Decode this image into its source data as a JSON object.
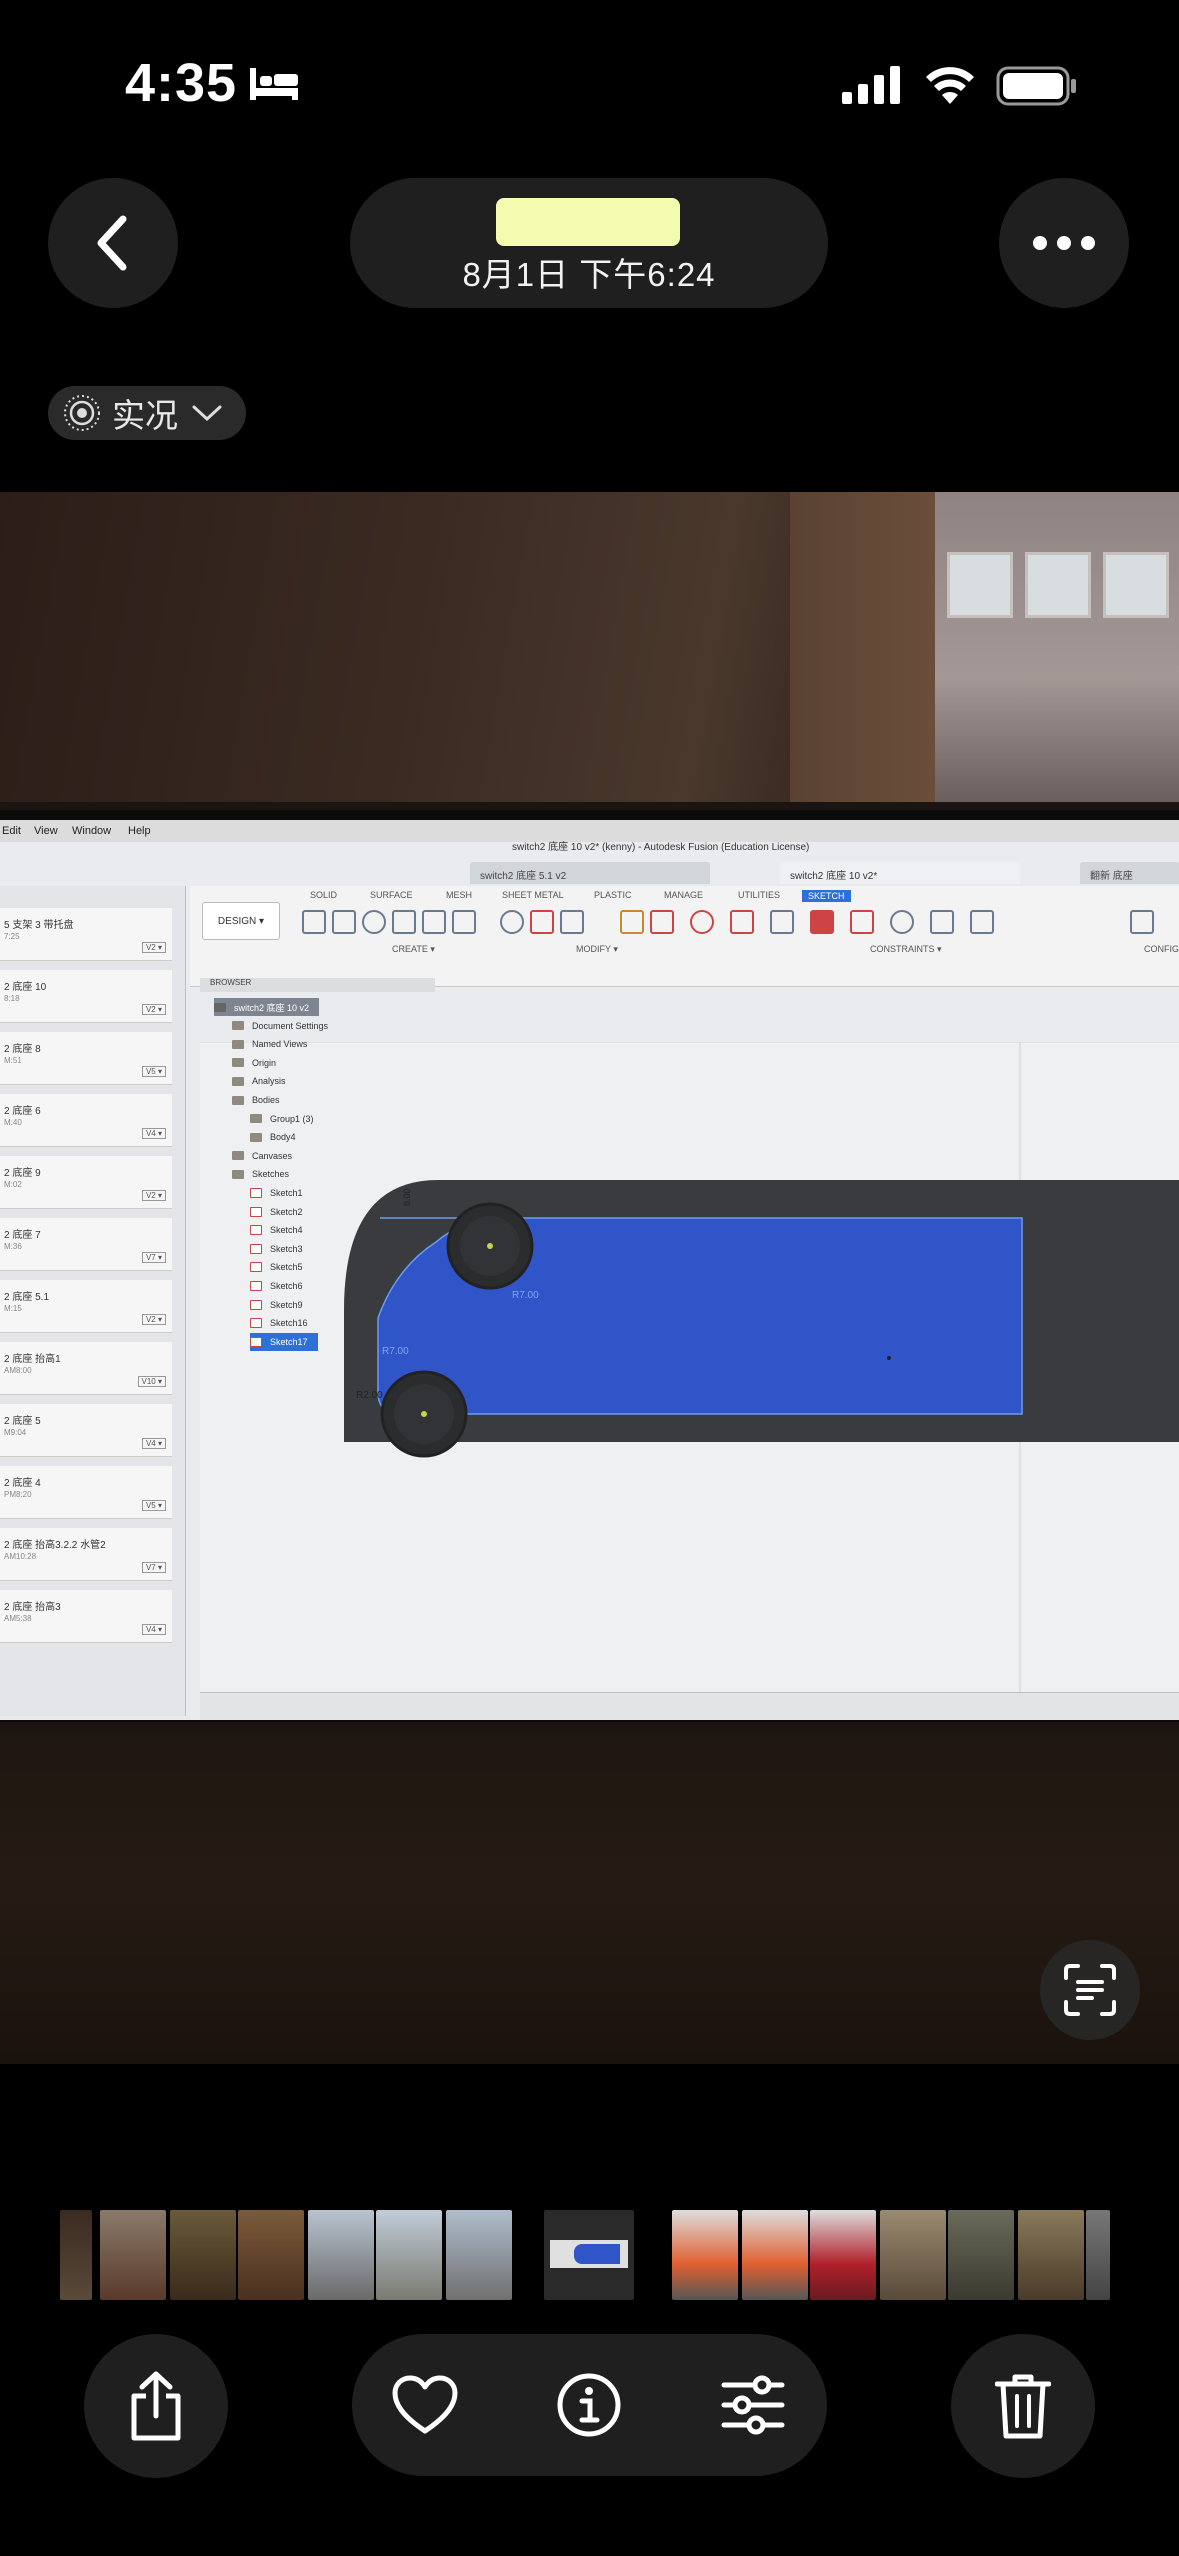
{
  "status_bar": {
    "time": "4:35"
  },
  "header": {
    "date": "8月1日  下午6:24",
    "live_badge": "实况"
  },
  "screenshot_app": {
    "menu": [
      "Edit",
      "View",
      "Window",
      "Help"
    ],
    "window_title": "switch2 底座 10 v2* (kenny) - Autodesk Fusion (Education License)",
    "doc_tabs": [
      "switch2 底座 5.1 v2",
      "switch2 底座 10 v2*",
      "翻新 底座"
    ],
    "workspace_button": "DESIGN ▾",
    "toolbar_tabs": [
      "SOLID",
      "SURFACE",
      "MESH",
      "SHEET METAL",
      "PLASTIC",
      "MANAGE",
      "UTILITIES",
      "SKETCH"
    ],
    "toolbar_groups": [
      "CREATE ▾",
      "MODIFY ▾",
      "CONSTRAINTS ▾",
      "CONFIG"
    ],
    "data_panel_items": [
      {
        "name": "5 支架 3 带托盘",
        "time": "7:25",
        "ver": "V2 ▾"
      },
      {
        "name": "2 底座 10",
        "time": "8:18",
        "ver": "V2 ▾"
      },
      {
        "name": "2 底座 8",
        "time": "M:51",
        "ver": "V5 ▾"
      },
      {
        "name": "2 底座 6",
        "time": "M:40",
        "ver": "V4 ▾"
      },
      {
        "name": "2 底座 9",
        "time": "M:02",
        "ver": "V2 ▾"
      },
      {
        "name": "2 底座 7",
        "time": "M:36",
        "ver": "V7 ▾"
      },
      {
        "name": "2 底座 5.1",
        "time": "M:15",
        "ver": "V2 ▾"
      },
      {
        "name": "2 底座 抬高1",
        "time": "AM8:00",
        "ver": "V10 ▾"
      },
      {
        "name": "2 底座 5",
        "time": "M9:04",
        "ver": "V4 ▾"
      },
      {
        "name": "2 底座 4",
        "time": "PM8:20",
        "ver": "V5 ▾"
      },
      {
        "name": "2 底座 抬高3.2.2 水管2",
        "time": "AM10:28",
        "ver": "V7 ▾"
      },
      {
        "name": "2 底座 抬高3",
        "time": "AM5:38",
        "ver": "V4 ▾"
      }
    ],
    "browser": {
      "title": "BROWSER",
      "items": [
        {
          "label": "switch2 底座 10 v2",
          "indent": 0,
          "kind": "root"
        },
        {
          "label": "Document Settings",
          "indent": 1,
          "kind": "folder"
        },
        {
          "label": "Named Views",
          "indent": 1,
          "kind": "folder"
        },
        {
          "label": "Origin",
          "indent": 1,
          "kind": "folder"
        },
        {
          "label": "Analysis",
          "indent": 1,
          "kind": "folder"
        },
        {
          "label": "Bodies",
          "indent": 1,
          "kind": "folder"
        },
        {
          "label": "Group1 (3)",
          "indent": 2,
          "kind": "folder"
        },
        {
          "label": "Body4",
          "indent": 2,
          "kind": "body"
        },
        {
          "label": "Canvases",
          "indent": 1,
          "kind": "folder"
        },
        {
          "label": "Sketches",
          "indent": 1,
          "kind": "folder"
        },
        {
          "label": "Sketch1",
          "indent": 2,
          "kind": "sketch"
        },
        {
          "label": "Sketch2",
          "indent": 2,
          "kind": "sketch"
        },
        {
          "label": "Sketch4",
          "indent": 2,
          "kind": "sketch"
        },
        {
          "label": "Sketch3",
          "indent": 2,
          "kind": "sketch"
        },
        {
          "label": "Sketch5",
          "indent": 2,
          "kind": "sketch"
        },
        {
          "label": "Sketch6",
          "indent": 2,
          "kind": "sketch"
        },
        {
          "label": "Sketch9",
          "indent": 2,
          "kind": "sketch"
        },
        {
          "label": "Sketch16",
          "indent": 2,
          "kind": "sketch"
        },
        {
          "label": "Sketch17",
          "indent": 2,
          "kind": "sketch-selected"
        }
      ]
    },
    "dimensions": [
      "R7.00",
      "R7.00",
      "R2.00",
      "8.00"
    ]
  },
  "colors": {
    "sketch_fill": "#2f55c9",
    "body_dark": "#3a3b3e",
    "selection": "#2e6fd8",
    "redaction": "#f3fbb0"
  },
  "icons": {
    "back": "chevron-left-icon",
    "more": "ellipsis-icon",
    "share": "share-icon",
    "favorite": "heart-icon",
    "info": "info-icon",
    "adjust": "sliders-icon",
    "delete": "trash-icon",
    "live_text": "live-text-icon"
  }
}
